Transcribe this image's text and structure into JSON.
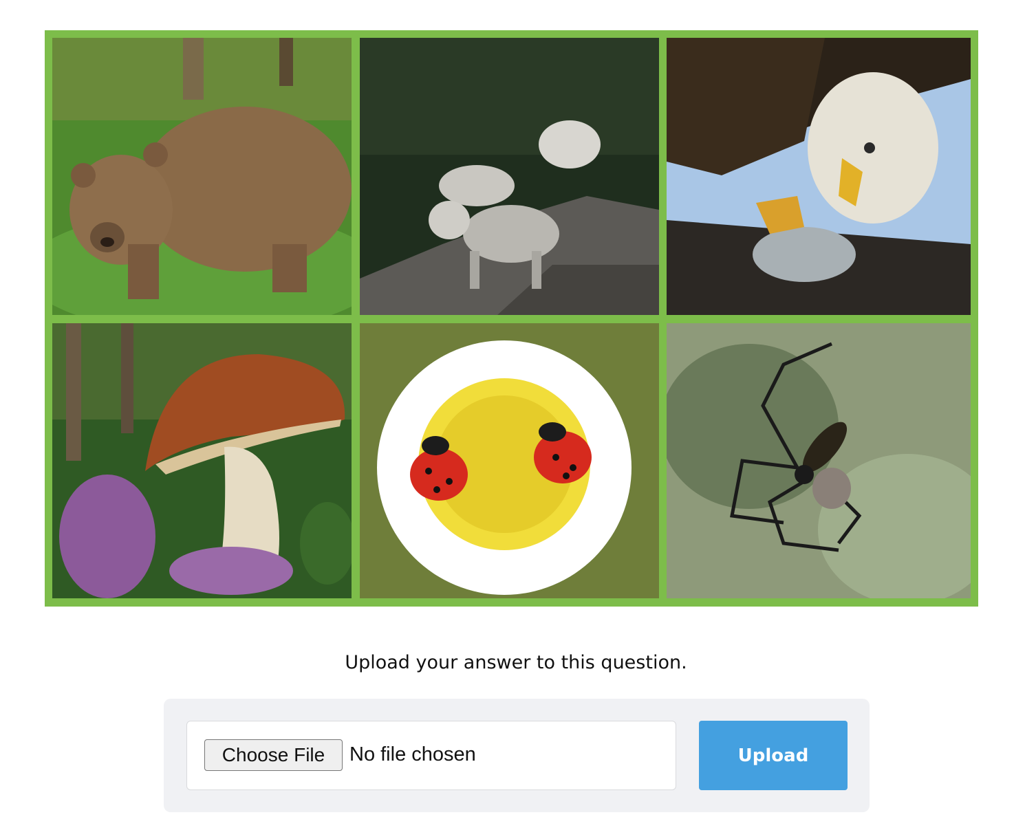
{
  "gallery": {
    "border_color": "#7dbd4a",
    "images": [
      {
        "subject": "brown bear"
      },
      {
        "subject": "arctic wolves"
      },
      {
        "subject": "bald eagle with fish"
      },
      {
        "subject": "porcini mushroom"
      },
      {
        "subject": "ladybugs on daisy"
      },
      {
        "subject": "spider in web"
      }
    ]
  },
  "question": {
    "prompt": "Upload your answer to this question."
  },
  "upload": {
    "choose_label": "Choose File",
    "file_status": "No file chosen",
    "submit_label": "Upload",
    "accent_color": "#44a0e0"
  }
}
